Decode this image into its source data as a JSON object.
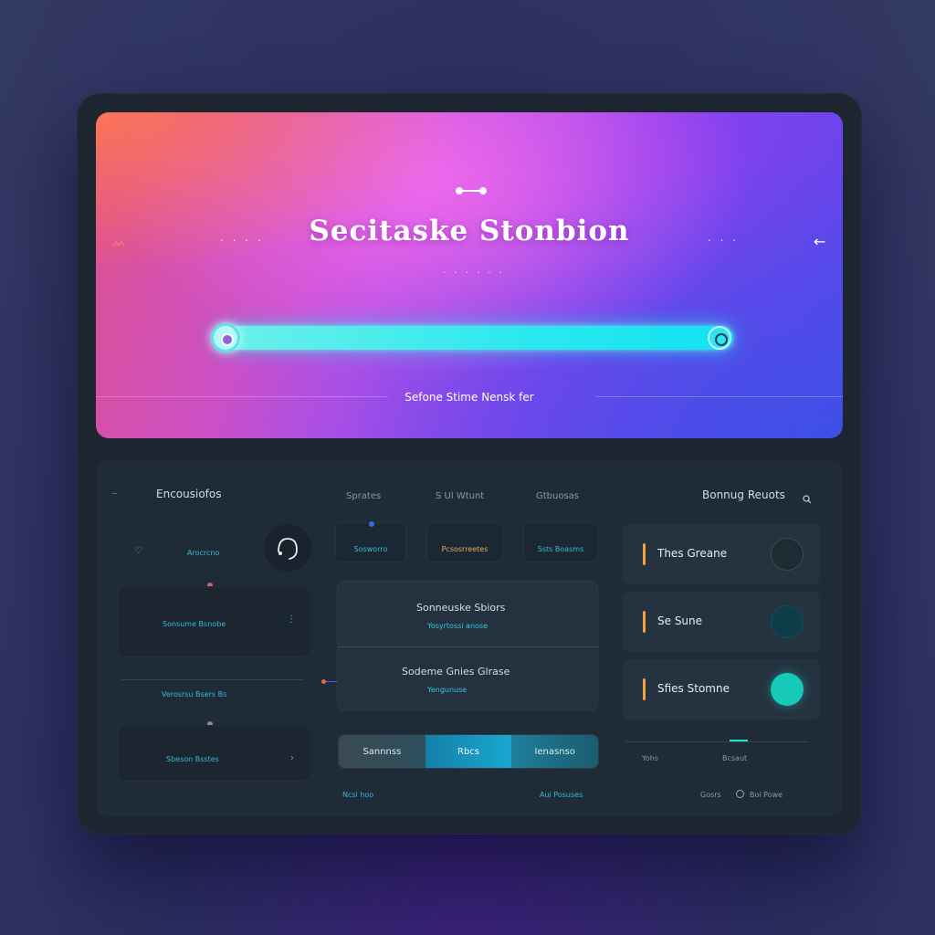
{
  "hero": {
    "title": "Secitaske Stonbion",
    "caption": "Sefone Stime Nensk fer",
    "progress": 1.0,
    "dots_left": ". . . .",
    "dots_right": ". . .",
    "dots_under": ". . . . . ."
  },
  "panel": {
    "left_header": "Encousiofos",
    "tabs": [
      "Sprates",
      "S Ul Wtunt",
      "Gtbuosas"
    ],
    "right_header": "Bonnug Reuots",
    "left_cards": [
      {
        "label": "Arocrcno"
      },
      {
        "label": "Sonsume Bsnobe"
      },
      {
        "label": "Verosrsu Bsers Bs"
      },
      {
        "label": "Sbeson Bsstes"
      }
    ],
    "tiles": [
      "Sosworro",
      "Pcsosrreetes",
      "Ssts Boasms"
    ],
    "center_cards": [
      {
        "title": "Sonneuske Sbiors",
        "sub": "Yosyrtossi anose"
      },
      {
        "title": "Sodeme Gnies Glrase",
        "sub": "Yengunuse"
      }
    ],
    "segments": [
      "Sannnss",
      "Rbcs",
      "Ienasnso"
    ],
    "right_rows": [
      {
        "label": "Thes Greane",
        "accent": "#f1a23a",
        "circle": "#1f2b33"
      },
      {
        "label": "Se Sune",
        "accent": "#f1a23a",
        "circle": "#0e3d4a"
      },
      {
        "label": "Sfies Stomne",
        "accent": "#f1a23a",
        "circle": "#17c9b8"
      }
    ],
    "footer": {
      "left": "Ncsi hoo",
      "center": "Aui Posuses",
      "right_a": "Yohs",
      "right_b": "Bcsaut",
      "right_c": "Gosrs",
      "right_d": "Boi Powe"
    }
  },
  "colors": {
    "accent_cyan": "#1ee6f0",
    "accent_orange": "#f1a23a",
    "panel_bg": "#1f2b37"
  }
}
